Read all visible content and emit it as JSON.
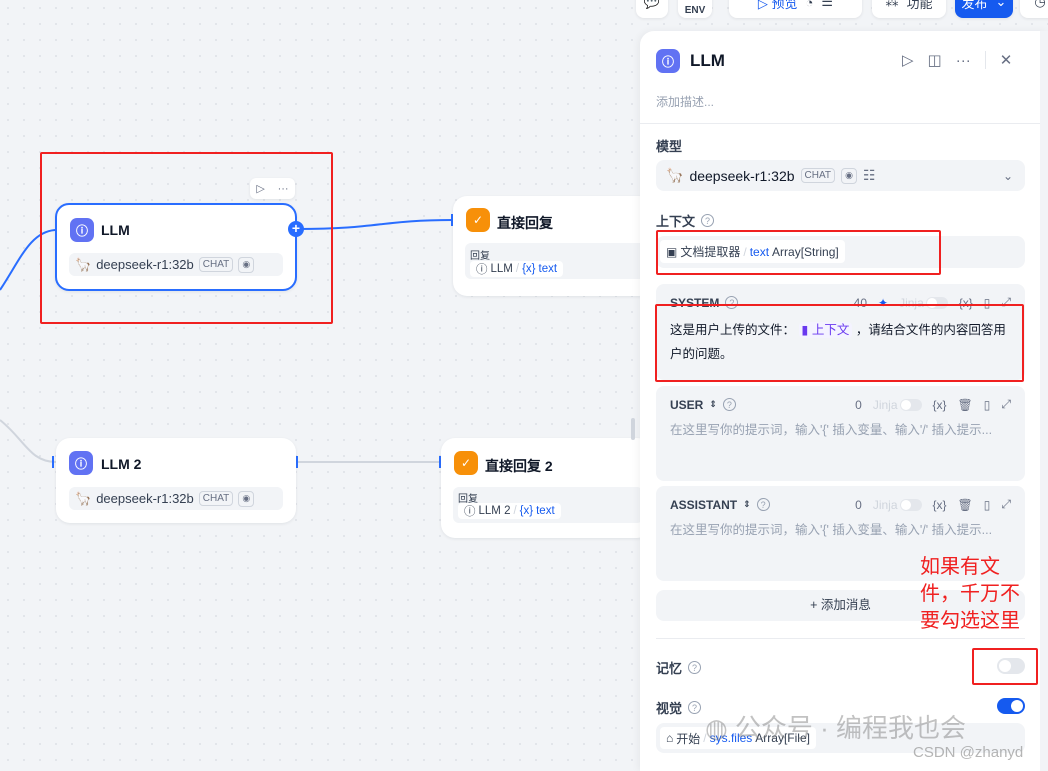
{
  "toolbar": {
    "env": "ENV",
    "preview": "预览",
    "features": "功能",
    "publish": "发布"
  },
  "nodes": {
    "llm": {
      "title": "LLM",
      "model": "deepseek-r1:32b",
      "badge": "CHAT"
    },
    "reply": {
      "title": "直接回复",
      "label": "回复",
      "src": "LLM",
      "var": "text"
    },
    "llm2": {
      "title": "LLM 2",
      "model": "deepseek-r1:32b",
      "badge": "CHAT"
    },
    "reply2": {
      "title": "直接回复 2",
      "label": "回复",
      "src": "LLM 2",
      "var": "text"
    }
  },
  "panel": {
    "title": "LLM",
    "description_placeholder": "添加描述...",
    "model_label": "模型",
    "model": "deepseek-r1:32b",
    "model_badge": "CHAT",
    "context_label": "上下文",
    "context_node": "文档提取器",
    "context_var": "text",
    "context_type": "Array[String]",
    "messages": [
      {
        "role": "SYSTEM",
        "count": "40",
        "text_before": "这是用户上传的文件：",
        "ctx": "上下文",
        "text_after": "，请结合文件的内容回答用户的问题。"
      },
      {
        "role": "USER",
        "count": "0",
        "placeholder": "在这里写你的提示词，输入'{' 插入变量、输入'/' 插入提示..."
      },
      {
        "role": "ASSISTANT",
        "count": "0",
        "placeholder": "在这里写你的提示词，输入'{' 插入变量、输入'/' 插入提示..."
      }
    ],
    "jinja": "Jinja",
    "var_icon": "{x}",
    "add_message": "+ 添加消息",
    "memory_label": "记忆",
    "memory_enabled": false,
    "vision_label": "视觉",
    "vision_enabled": true,
    "vision_node": "开始",
    "vision_var": "sys.files",
    "vision_type": "Array[File]"
  },
  "annotation": {
    "line1": "如果有文",
    "line2": "件，千万不",
    "line3": "要勾选这里"
  },
  "watermark": {
    "wechat": "公众号 · 编程我也会",
    "csdn": "CSDN @zhanyd"
  },
  "colors": {
    "accent": "#155aef",
    "llm_icon": "#6172f3",
    "reply_icon": "#f79009",
    "annotation": "#f02020"
  }
}
